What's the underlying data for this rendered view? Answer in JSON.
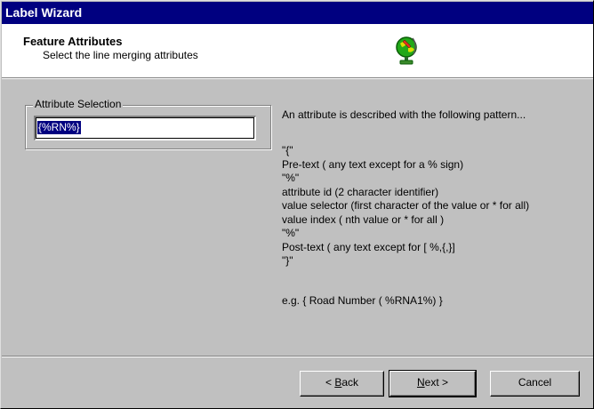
{
  "window": {
    "title": "Label Wizard"
  },
  "header": {
    "title": "Feature Attributes",
    "subtitle": "Select the line merging attributes",
    "icon": "globe-icon"
  },
  "attribute_selection": {
    "legend": "Attribute Selection",
    "value": "{%RN%}"
  },
  "description": {
    "intro": "An attribute is described with the following pattern...",
    "pattern_lines": [
      "\"{\"",
      "Pre-text ( any text except for a % sign)",
      "\"%\"",
      "attribute id (2 character identifier)",
      "value selector (first character of the value or * for all)",
      "value index ( nth value or * for all )",
      "\"%\"",
      "Post-text ( any text except for [ %,{,}]",
      "\"}\""
    ],
    "example": "e.g. { Road Number ( %RNA1%) }"
  },
  "buttons": {
    "back": {
      "prefix": "< ",
      "mnemonic": "B",
      "rest": "ack"
    },
    "next": {
      "mnemonic": "N",
      "rest": "ext >"
    },
    "cancel": "Cancel"
  }
}
